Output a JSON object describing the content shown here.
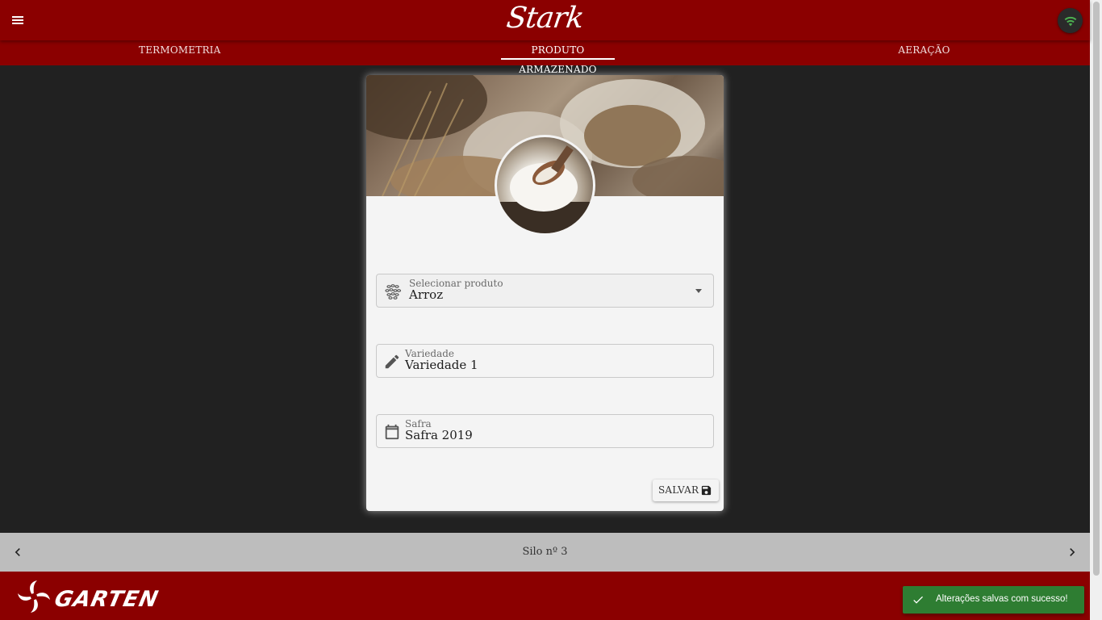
{
  "app": {
    "brand": "Stark",
    "menu_icon": "menu-icon",
    "connection_icon": "wifi-icon",
    "connection_color": "#4caf50"
  },
  "tabs": [
    {
      "label": "TERMOMETRIA",
      "active": false
    },
    {
      "label": "PRODUTO ARMAZENADO",
      "active": true
    },
    {
      "label": "AERAÇÃO",
      "active": false
    }
  ],
  "form": {
    "product": {
      "label": "Selecionar produto",
      "value": "Arroz",
      "icon": "grains-icon"
    },
    "variety": {
      "label": "Variedade",
      "value": "Variedade 1",
      "icon": "pencil-icon"
    },
    "harvest": {
      "label": "Safra",
      "value": "Safra 2019",
      "icon": "calendar-icon"
    },
    "save_label": "SALVAR",
    "save_icon": "floppy-disk-icon"
  },
  "silo": {
    "label": "Silo nº 3",
    "prev_icon": "chevron-left-icon",
    "next_icon": "chevron-right-icon"
  },
  "footer": {
    "logo_text": "GARTEN"
  },
  "toast": {
    "message": "Alterações salvas com sucesso!",
    "icon": "check-icon",
    "color": "#2e7d32"
  },
  "colors": {
    "primary": "#8b0000",
    "background": "#212121",
    "card": "#f4f4f4"
  }
}
